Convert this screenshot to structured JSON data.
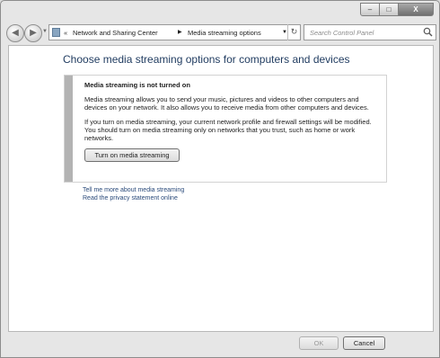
{
  "window": {
    "minimize_glyph": "–",
    "maximize_glyph": "□",
    "close_glyph": "X"
  },
  "nav": {
    "back_glyph": "◀",
    "forward_glyph": "▶",
    "address": {
      "chevron": "«",
      "crumb1": "Network and Sharing Center",
      "separator": "▶",
      "crumb2": "Media streaming options"
    },
    "search_placeholder": "Search Control Panel"
  },
  "main": {
    "title": "Choose media streaming options for computers and devices",
    "info": {
      "heading": "Media streaming is not turned on",
      "paragraph1": "Media streaming allows you to send your music, pictures and videos to other computers and devices on your network. It also allows you to receive media from other computers and devices.",
      "paragraph2": "If you turn on media streaming, your current network profile and firewall settings will be modified. You should turn on media streaming only on networks that you trust, such as home or work networks.",
      "button_label": "Turn on media streaming"
    },
    "links": [
      "Tell me more about media streaming",
      "Read the privacy statement online"
    ]
  },
  "footer": {
    "ok_label": "OK",
    "cancel_label": "Cancel"
  }
}
